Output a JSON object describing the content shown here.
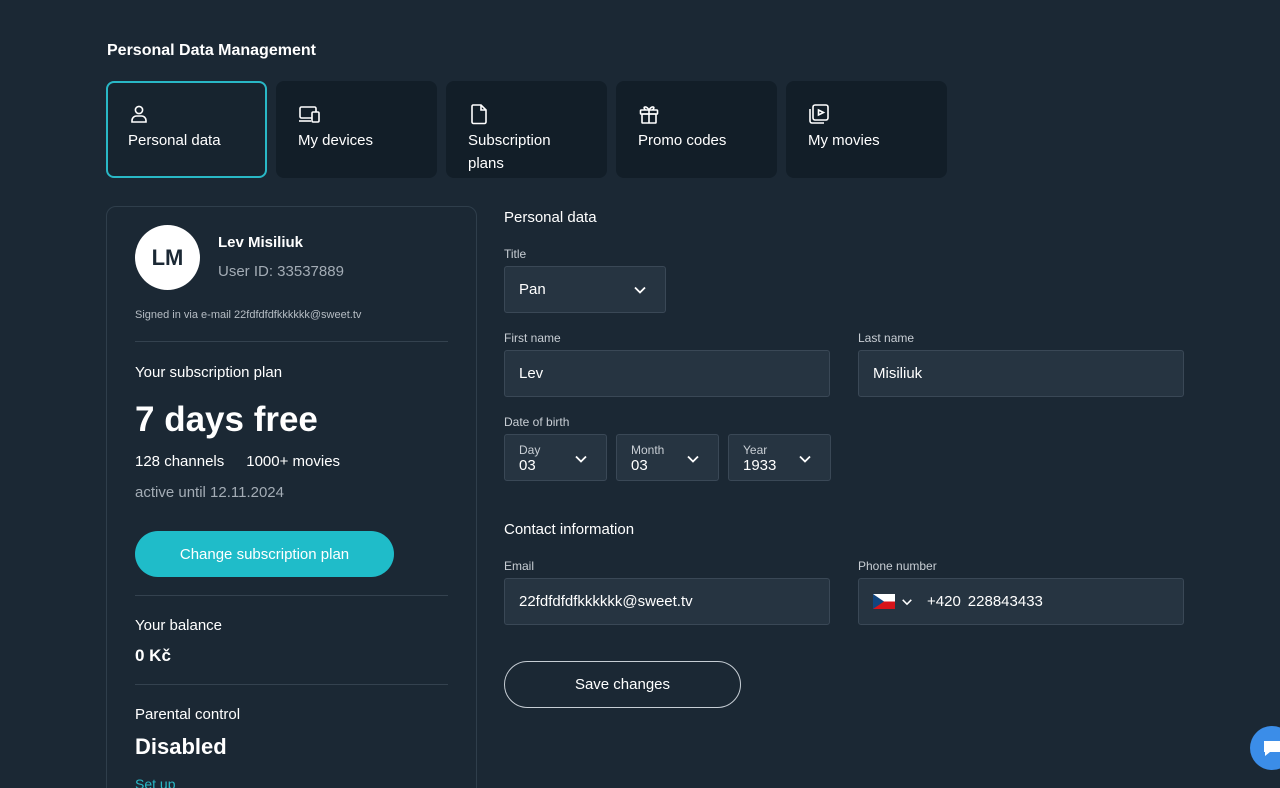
{
  "page": {
    "title": "Personal Data Management"
  },
  "tabs": [
    {
      "label": "Personal data",
      "icon": "user-icon",
      "active": true
    },
    {
      "label": "My devices",
      "icon": "devices-icon",
      "active": false
    },
    {
      "label": "Subscription plans",
      "icon": "document-icon",
      "active": false
    },
    {
      "label": "Promo codes",
      "icon": "gift-icon",
      "active": false
    },
    {
      "label": "My movies",
      "icon": "movie-icon",
      "active": false
    }
  ],
  "profile": {
    "initials": "LM",
    "name": "Lev Misiliuk",
    "user_id": "User ID: 33537889",
    "signed_in": "Signed in via e-mail 22fdfdfdfkkkkkk@sweet.tv"
  },
  "subscription": {
    "heading": "Your subscription plan",
    "plan_name": "7 days free",
    "channels": "128 channels",
    "movies": "1000+ movies",
    "active_until": "active until 12.11.2024",
    "change_button": "Change subscription plan"
  },
  "balance": {
    "heading": "Your balance",
    "value": "0 Kč"
  },
  "parental": {
    "heading": "Parental control",
    "value": "Disabled",
    "link": "Set up"
  },
  "personal_form": {
    "section_title": "Personal data",
    "title_label": "Title",
    "title_value": "Pan",
    "first_name_label": "First name",
    "first_name_value": "Lev",
    "last_name_label": "Last name",
    "last_name_value": "Misiliuk",
    "dob_label": "Date of birth",
    "day_label": "Day",
    "day_value": "03",
    "month_label": "Month",
    "month_value": "03",
    "year_label": "Year",
    "year_value": "1933"
  },
  "contact_form": {
    "section_title": "Contact information",
    "email_label": "Email",
    "email_value": "22fdfdfdfkkkkkk@sweet.tv",
    "phone_label": "Phone number",
    "phone_prefix": "+420",
    "phone_value": "228843433",
    "flag_icon": "czech-flag-icon"
  },
  "actions": {
    "save_label": "Save changes"
  },
  "colors": {
    "background": "#1b2834",
    "accent": "#1fbcc9",
    "tab_bg": "#121e28",
    "input_bg": "#263441",
    "chat": "#3b8de8"
  }
}
